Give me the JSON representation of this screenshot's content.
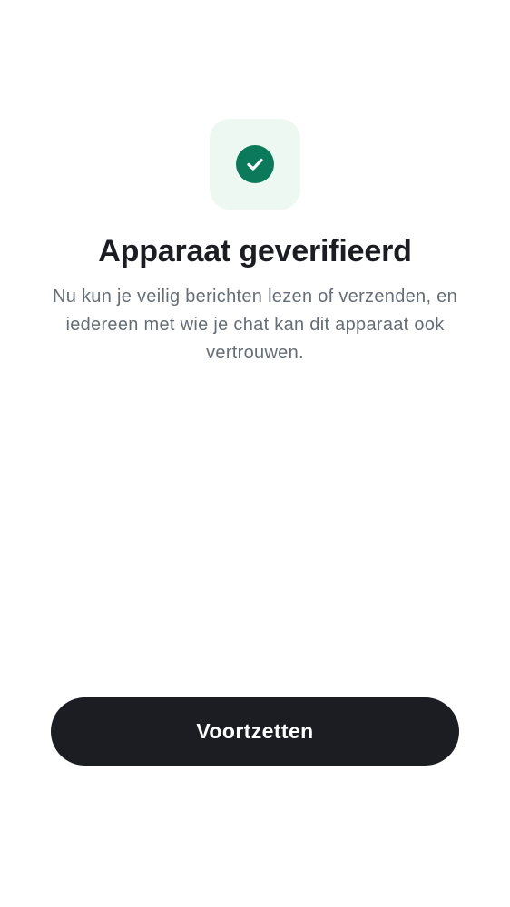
{
  "verification": {
    "status_icon": "check-circle-icon",
    "title": "Apparaat geverifieerd",
    "description": "Nu kun je veilig berichten lezen of verzenden, en iedereen met wie je chat kan dit apparaat ook vertrouwen."
  },
  "actions": {
    "continue_label": "Voortzetten"
  },
  "colors": {
    "background": "#ffffff",
    "icon_tile": "#eef8f3",
    "success": "#0b7a5a",
    "title_text": "#1b1d22",
    "body_text": "#656d77",
    "button_background": "#1b1d22",
    "button_text": "#ffffff"
  }
}
